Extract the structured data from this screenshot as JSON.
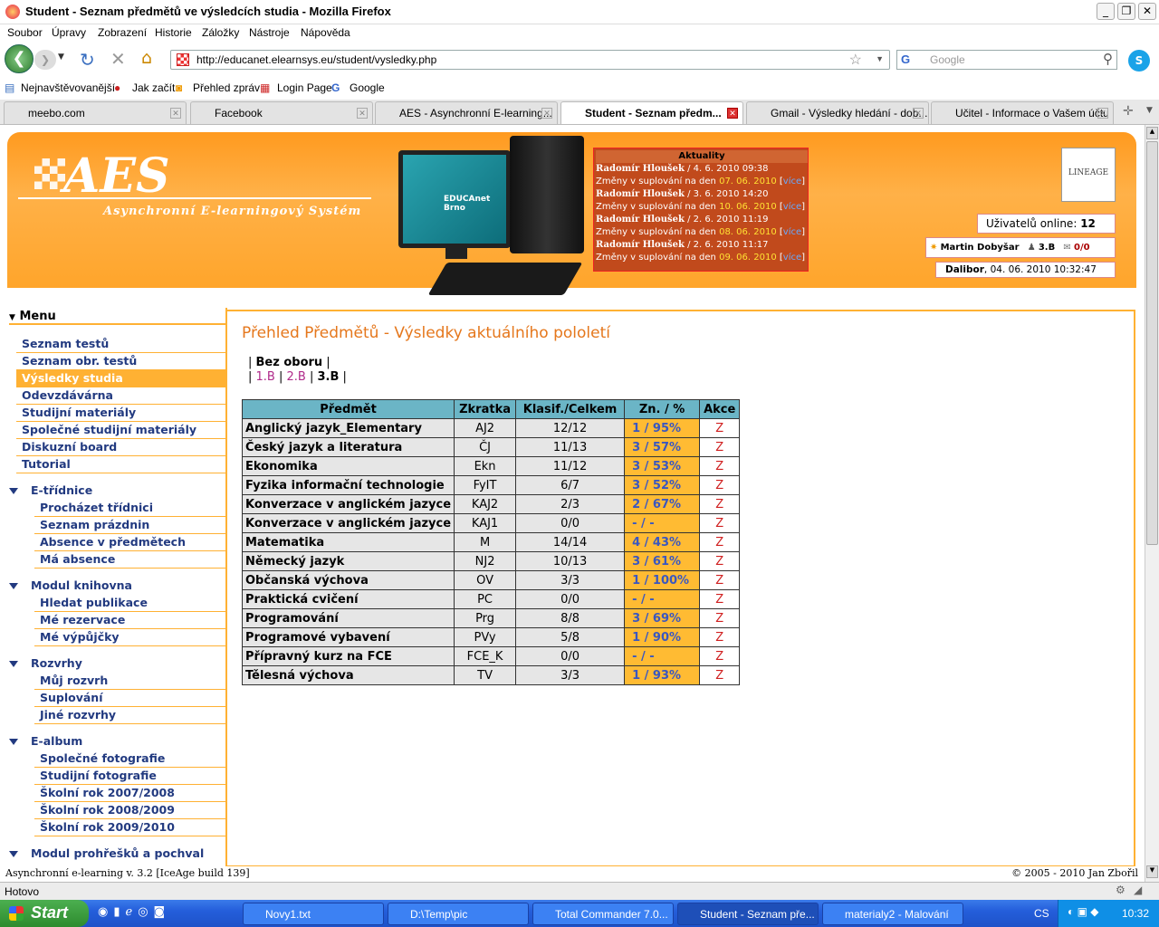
{
  "window": {
    "title": "Student - Seznam předmětů ve výsledcích studia - Mozilla Firefox"
  },
  "menubar": [
    "Soubor",
    "Úpravy",
    "Zobrazení",
    "Historie",
    "Záložky",
    "Nástroje",
    "Nápověda"
  ],
  "nav": {
    "url": "http://educanet.elearnsys.eu/student/vysledky.php",
    "search_placeholder": "Google"
  },
  "bookmarks": [
    "Nejnavštěvovanější",
    "Jak začít",
    "Přehled zpráv",
    "Login Page",
    "Google"
  ],
  "tabs": [
    "meebo.com",
    "Facebook",
    "AES - Asynchronní E-learning...",
    "Student - Seznam předm...",
    "Gmail - Výsledky hledání - dob...",
    "Učitel - Informace o Vašem účtu"
  ],
  "header": {
    "logo": "AES",
    "subtitle": "Asynchronní E-learningový Systém",
    "monitor_text": "EDUCAnet Brno",
    "news_title": "Aktuality",
    "news": [
      {
        "author": "Radomír Hloušek",
        "when": " / 4. 6. 2010 09:38",
        "text": "Změny v suplování na den ",
        "date": "07. 06. 2010",
        "link": "více"
      },
      {
        "author": "Radomír Hloušek",
        "when": " / 3. 6. 2010 14:20",
        "text": "Změny v suplování na den ",
        "date": "10. 06. 2010",
        "link": "více"
      },
      {
        "author": "Radomír Hloušek",
        "when": " / 2. 6. 2010 11:19",
        "text": "Změny v suplování na den ",
        "date": "08. 06. 2010",
        "link": "více"
      },
      {
        "author": "Radomír Hloušek",
        "when": " / 2. 6. 2010 11:17",
        "text": "Změny v suplování na den ",
        "date": "09. 06. 2010",
        "link": "více"
      }
    ],
    "lineage": "LINEAGE",
    "online_label": "Uživatelů online:",
    "online_count": "12",
    "user_name": "Martin Dobyšar",
    "user_class": "3.B",
    "messages": "0/0",
    "greeting_name": "Dalibor",
    "datetime": ", 04. 06. 2010 10:32:47"
  },
  "menu": {
    "title": "Menu",
    "items": [
      "Seznam testů",
      "Seznam obr. testů",
      "Výsledky studia",
      "Odevzdávárna",
      "Studijní materiály",
      "Společné studijní materiály",
      "Diskuzní board",
      "Tutorial"
    ],
    "sections": [
      {
        "title": "E-třídnice",
        "items": [
          "Procházet třídnici",
          "Seznam prázdnin",
          "Absence v předmětech",
          "Má absence"
        ]
      },
      {
        "title": "Modul knihovna",
        "items": [
          "Hledat publikace",
          "Mé rezervace",
          "Mé výpůjčky"
        ]
      },
      {
        "title": "Rozvrhy",
        "items": [
          "Můj rozvrh",
          "Suplování",
          "Jiné rozvrhy"
        ]
      },
      {
        "title": "E-album",
        "items": [
          "Společné fotografie",
          "Studijní fotografie",
          "Školní rok 2007/2008",
          "Školní rok 2008/2009",
          "Školní rok 2009/2010"
        ]
      },
      {
        "title": "Modul prohřešků a pochval",
        "items": []
      }
    ]
  },
  "content": {
    "title": "Přehled Předmětů - Výsledky aktuálního pololetí",
    "group": "Bez oboru",
    "classes": [
      "1.B",
      "2.B",
      "3.B"
    ],
    "columns": [
      "Předmět",
      "Zkratka",
      "Klasif./Celkem",
      "Zn. / %",
      "Akce"
    ],
    "rows": [
      [
        "Anglický jazyk_Elementary",
        "AJ2",
        "12/12",
        "1 / 95%",
        "Z"
      ],
      [
        "Český jazyk a literatura",
        "ČJ",
        "11/13",
        "3 / 57%",
        "Z"
      ],
      [
        "Ekonomika",
        "Ekn",
        "11/12",
        "3 / 53%",
        "Z"
      ],
      [
        "Fyzika informační technologie",
        "FyIT",
        "6/7",
        "3 / 52%",
        "Z"
      ],
      [
        "Konverzace v anglickém jazyce",
        "KAJ2",
        "2/3",
        "2 / 67%",
        "Z"
      ],
      [
        "Konverzace v anglickém jazyce",
        "KAJ1",
        "0/0",
        "- / -",
        "Z"
      ],
      [
        "Matematika",
        "M",
        "14/14",
        "4 / 43%",
        "Z"
      ],
      [
        "Německý jazyk",
        "NJ2",
        "10/13",
        "3 / 61%",
        "Z"
      ],
      [
        "Občanská výchova",
        "OV",
        "3/3",
        "1 / 100%",
        "Z"
      ],
      [
        "Praktická cvičení",
        "PC",
        "0/0",
        "- / -",
        "Z"
      ],
      [
        "Programování",
        "Prg",
        "8/8",
        "3 / 69%",
        "Z"
      ],
      [
        "Programové vybavení",
        "PVy",
        "5/8",
        "1 / 90%",
        "Z"
      ],
      [
        "Přípravný kurz na FCE",
        "FCE_K",
        "0/0",
        "- / -",
        "Z"
      ],
      [
        "Tělesná výchova",
        "TV",
        "3/3",
        "1 / 93%",
        "Z"
      ]
    ]
  },
  "footer": {
    "left": "Asynchronní e-learning  v. 3.2 [IceAge build 139]",
    "right": "© 2005 - 2010  Jan Zbořil"
  },
  "status": "Hotovo",
  "taskbar": {
    "start": "Start",
    "tasks": [
      "Novy1.txt",
      "D:\\Temp\\pic",
      "Total Commander 7.0...",
      "Student - Seznam pře...",
      "materialy2 - Malování"
    ],
    "lang": "CS",
    "clock": "10:32"
  },
  "colors": {
    "orange": "#ffb133",
    "header": "#ff9a1f",
    "menu_text": "#223a80",
    "table_head": "#6bb5c6",
    "title": "#e5771c"
  }
}
